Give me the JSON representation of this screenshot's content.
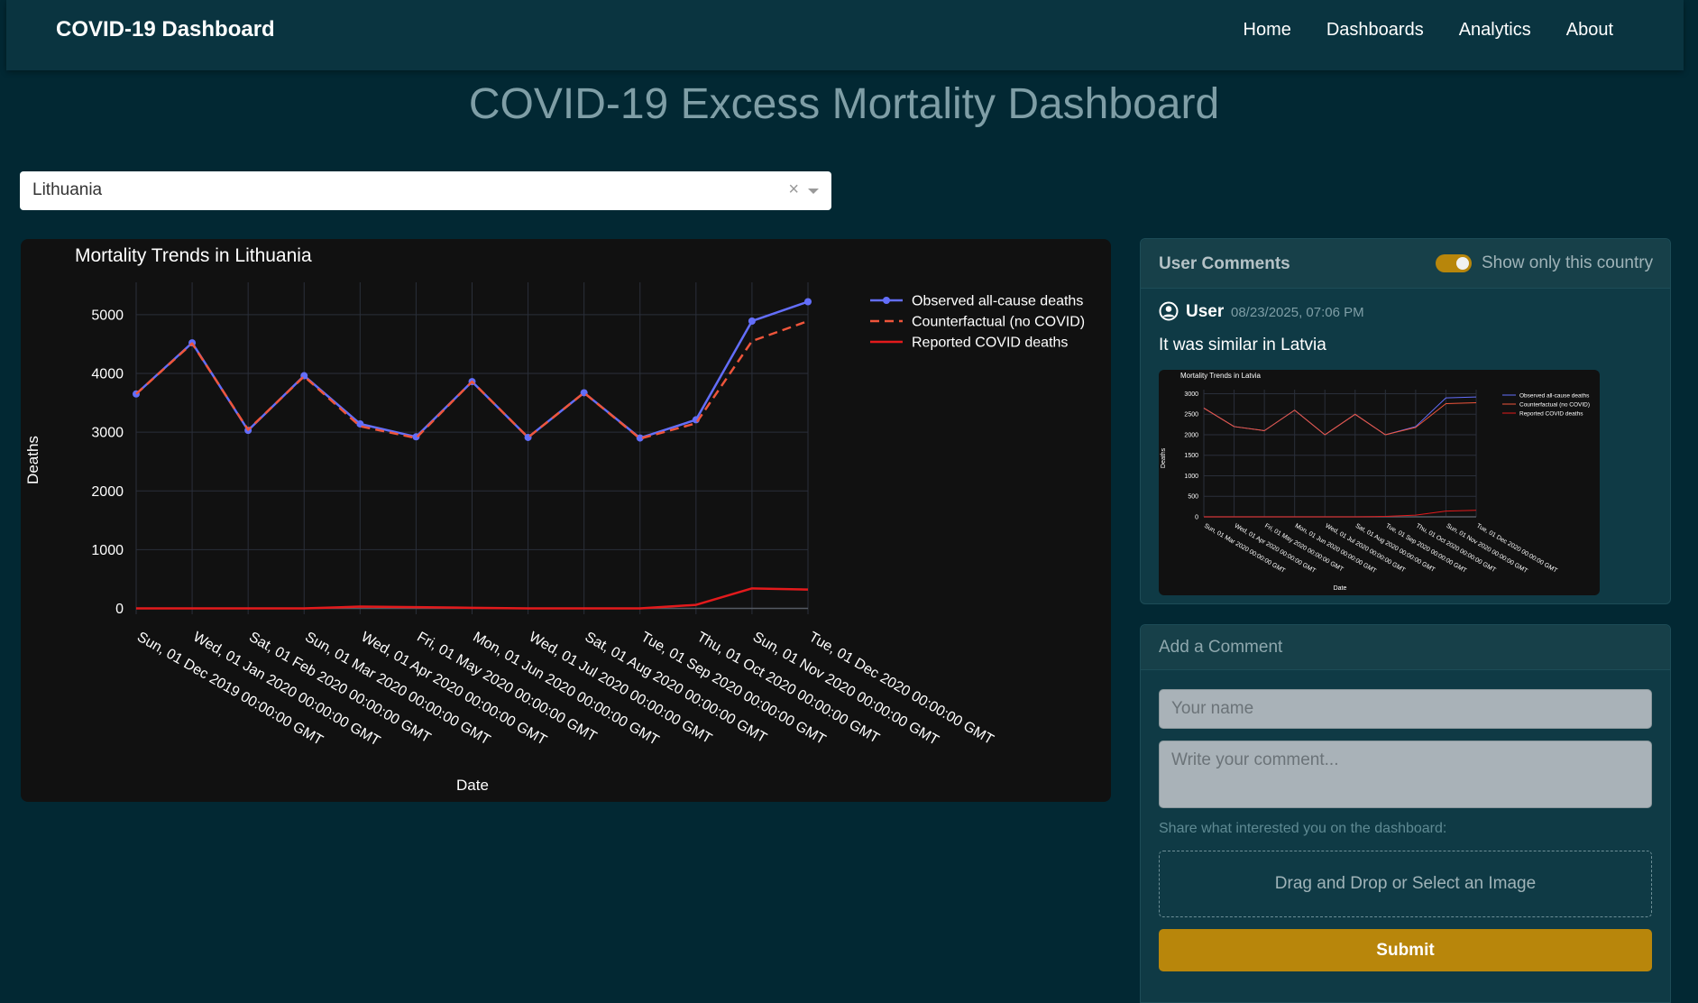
{
  "navbar": {
    "brand": "COVID-19 Dashboard",
    "links": [
      "Home",
      "Dashboards",
      "Analytics",
      "About"
    ]
  },
  "page": {
    "title": "COVID-19 Excess Mortality Dashboard"
  },
  "country_select": {
    "value": "Lithuania",
    "clear": "×"
  },
  "chart_data": {
    "type": "line",
    "title": "Mortality Trends in Lithuania",
    "xlabel": "Date",
    "ylabel": "Deaths",
    "categories": [
      "Sun, 01 Dec 2019 00:00:00 GMT",
      "Wed, 01 Jan 2020 00:00:00 GMT",
      "Sat, 01 Feb 2020 00:00:00 GMT",
      "Sun, 01 Mar 2020 00:00:00 GMT",
      "Wed, 01 Apr 2020 00:00:00 GMT",
      "Fri, 01 May 2020 00:00:00 GMT",
      "Mon, 01 Jun 2020 00:00:00 GMT",
      "Wed, 01 Jul 2020 00:00:00 GMT",
      "Sat, 01 Aug 2020 00:00:00 GMT",
      "Tue, 01 Sep 2020 00:00:00 GMT",
      "Thu, 01 Oct 2020 00:00:00 GMT",
      "Sun, 01 Nov 2020 00:00:00 GMT",
      "Tue, 01 Dec 2020 00:00:00 GMT"
    ],
    "series": [
      {
        "name": "Observed all-cause deaths",
        "color": "#636efa",
        "dash": "solid",
        "markers": true,
        "values": [
          3650,
          4520,
          3030,
          3960,
          3140,
          2920,
          3860,
          2910,
          3670,
          2900,
          3210,
          4890,
          5220
        ]
      },
      {
        "name": "Counterfactual (no COVID)",
        "color": "#ef553b",
        "dash": "dashed",
        "markers": false,
        "values": [
          3650,
          4510,
          3040,
          3950,
          3100,
          2900,
          3860,
          2910,
          3670,
          2890,
          3150,
          4550,
          4890
        ]
      },
      {
        "name": "Reported COVID deaths",
        "color": "#e31a1c",
        "dash": "solid",
        "markers": false,
        "values": [
          0,
          0,
          0,
          0,
          30,
          20,
          10,
          0,
          0,
          0,
          60,
          340,
          320
        ]
      }
    ],
    "yticks": [
      0,
      1000,
      2000,
      3000,
      4000,
      5000
    ],
    "ylim": [
      -100,
      5550
    ],
    "grid": true,
    "legend": "top-right"
  },
  "comments": {
    "header": "User Comments",
    "toggle_label": "Show only this country",
    "toggle_on": true,
    "items": [
      {
        "user": "User",
        "date": "08/23/2025, 07:06 PM",
        "text": "It was similar in Latvia",
        "thumbnail_chart": {
          "type": "line",
          "title": "Mortality Trends in Latvia",
          "xlabel": "Date",
          "ylabel": "Deaths",
          "categories": [
            "Sun, 01 Mar 2020 00:00:00 GMT",
            "Wed, 01 Apr 2020 00:00:00 GMT",
            "Fri, 01 May 2020 00:00:00 GMT",
            "Mon, 01 Jun 2020 00:00:00 GMT",
            "Wed, 01 Jul 2020 00:00:00 GMT",
            "Sat, 01 Aug 2020 00:00:00 GMT",
            "Tue, 01 Sep 2020 00:00:00 GMT",
            "Thu, 01 Oct 2020 00:00:00 GMT",
            "Sun, 01 Nov 2020 00:00:00 GMT",
            "Tue, 01 Dec 2020 00:00:00 GMT"
          ],
          "series": [
            {
              "name": "Observed all-cause deaths",
              "color": "#636efa",
              "values": [
                2650,
                2200,
                2100,
                2600,
                2000,
                2500,
                2000,
                2200,
                2900,
                2920
              ]
            },
            {
              "name": "Counterfactual (no COVID)",
              "color": "#ef553b",
              "values": [
                2650,
                2200,
                2100,
                2600,
                2000,
                2500,
                2000,
                2180,
                2760,
                2780
              ]
            },
            {
              "name": "Reported COVID deaths",
              "color": "#e31a1c",
              "values": [
                0,
                0,
                0,
                0,
                0,
                0,
                10,
                40,
                140,
                160
              ]
            }
          ],
          "yticks": [
            0,
            500,
            1000,
            1500,
            2000,
            2500,
            3000
          ],
          "ylim": [
            0,
            3100
          ]
        }
      }
    ]
  },
  "add_comment": {
    "header": "Add a Comment",
    "name_placeholder": "Your name",
    "comment_placeholder": "Write your comment...",
    "help_text": "Share what interested you on the dashboard:",
    "dropzone_label": "Drag and Drop or Select an Image",
    "submit_label": "Submit"
  },
  "colors": {
    "page_bg": "#022833",
    "navbar_bg": "#0a3440",
    "chart_bg": "#111111",
    "accent": "#b8860b",
    "title_color": "#7f9ea6"
  }
}
